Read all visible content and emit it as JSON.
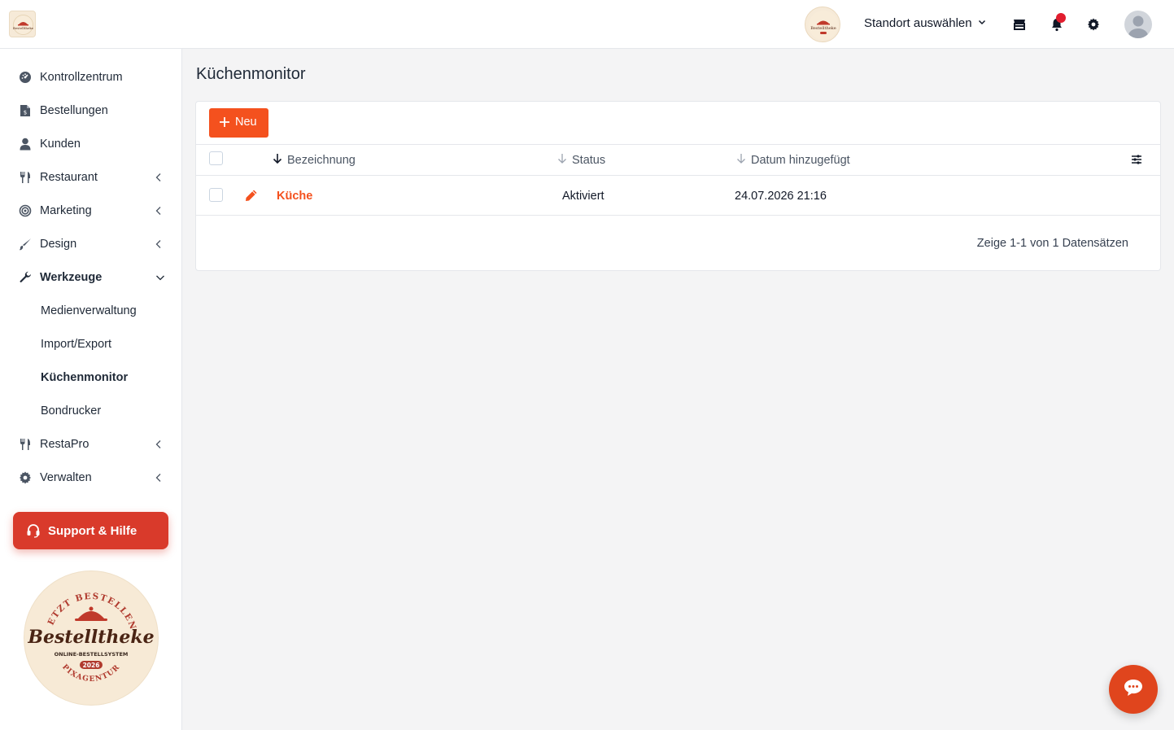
{
  "header": {
    "location_select": "Standort auswählen",
    "logo_icon": "bestelltheke-logo",
    "badge_icon": "bestelltheke-badge",
    "store_icon": "store-icon",
    "bell_icon": "bell-icon",
    "settings_icon": "gear-icon",
    "avatar_icon": "user-avatar"
  },
  "sidebar": {
    "items": [
      {
        "label": "Kontrollzentrum",
        "icon": "gauge-icon"
      },
      {
        "label": "Bestellungen",
        "icon": "receipt-icon"
      },
      {
        "label": "Kunden",
        "icon": "user-icon"
      },
      {
        "label": "Restaurant",
        "icon": "utensils-icon"
      },
      {
        "label": "Marketing",
        "icon": "target-icon"
      },
      {
        "label": "Design",
        "icon": "brush-icon"
      },
      {
        "label": "Werkzeuge",
        "icon": "wrench-icon"
      },
      {
        "label": "RestaPro",
        "icon": "utensils-icon"
      },
      {
        "label": "Verwalten",
        "icon": "gear-icon"
      }
    ],
    "subitems": [
      {
        "label": "Medienverwaltung"
      },
      {
        "label": "Import/Export"
      },
      {
        "label": "Küchenmonitor"
      },
      {
        "label": "Bondrucker"
      }
    ],
    "support_label": "Support & Hilfe",
    "logo_text": {
      "top": "JETZT BESTELLEN",
      "brand": "Bestelltheke",
      "subtitle": "ONLINE-BESTELLSYSTEM",
      "year": "2026",
      "bottom": "PIXAGENTUR"
    }
  },
  "main": {
    "title": "Küchenmonitor",
    "new_button": "Neu",
    "columns": [
      "Bezeichnung",
      "Status",
      "Datum hinzugefügt"
    ],
    "rows": [
      {
        "name": "Küche",
        "status": "Aktiviert",
        "date": "24.07.2026 21:16"
      }
    ],
    "pagination": "Zeige 1-1 von 1 Datensätzen"
  },
  "colors": {
    "accent": "#f4511e",
    "support": "#d93a2b",
    "notification": "#e11d2e"
  }
}
